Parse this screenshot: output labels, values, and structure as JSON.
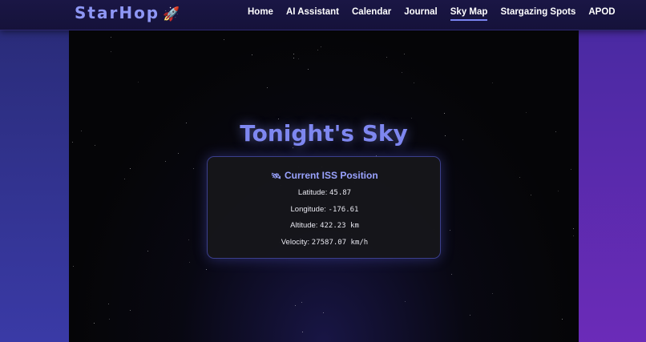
{
  "brand": {
    "name": "StarHop",
    "icon": "rocket-icon",
    "emoji": "🚀"
  },
  "nav": {
    "items": [
      {
        "label": "Home",
        "active": false
      },
      {
        "label": "AI Assistant",
        "active": false
      },
      {
        "label": "Calendar",
        "active": false
      },
      {
        "label": "Journal",
        "active": false
      },
      {
        "label": "Sky Map",
        "active": true
      },
      {
        "label": "Stargazing Spots",
        "active": false
      },
      {
        "label": "APOD",
        "active": false
      }
    ]
  },
  "main": {
    "title": "Tonight's Sky",
    "iss_card": {
      "icon": "satellite-icon",
      "icon_glyph": "🛰",
      "title": "Current ISS Position",
      "rows": [
        {
          "label": "Latitude:",
          "value": "45.87"
        },
        {
          "label": "Longitude:",
          "value": "-176.61"
        },
        {
          "label": "Altitude:",
          "value": "422.23 km"
        },
        {
          "label": "Velocity:",
          "value": "27587.07 km/h"
        }
      ]
    }
  },
  "colors": {
    "accent": "#7e87f0",
    "brand": "#8e97f5",
    "panel_bg": "#050507",
    "card_border": "#3b3f8c"
  }
}
